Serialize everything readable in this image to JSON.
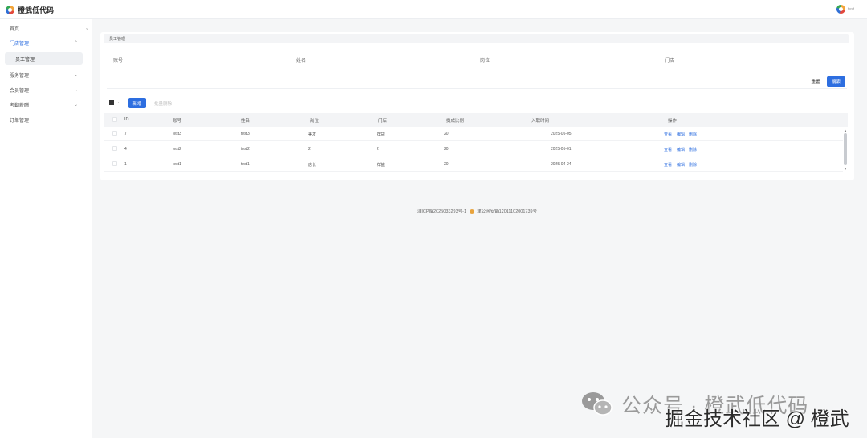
{
  "app": {
    "brand": "橙武低代码",
    "user": "test"
  },
  "sidebar": {
    "items": [
      {
        "label": "首页"
      },
      {
        "label": "门店管理"
      },
      {
        "label": "员工管理"
      },
      {
        "label": "服务管理"
      },
      {
        "label": "会员管理"
      },
      {
        "label": "考勤薪酬"
      },
      {
        "label": "订单管理"
      }
    ]
  },
  "breadcrumb": "员工管理",
  "filters": {
    "account": "账号",
    "name": "姓名",
    "position": "岗位",
    "store": "门店"
  },
  "buttons": {
    "reset": "重置",
    "search": "搜索",
    "new": "新增",
    "batch_delete": "批量删除"
  },
  "table": {
    "columns": [
      "ID",
      "账号",
      "姓名",
      "岗位",
      "门店",
      "提成比例",
      "入职时间",
      "操作"
    ],
    "rows": [
      {
        "id": "7",
        "account": "test3",
        "name": "test3",
        "position": "美发",
        "store": "祥益",
        "ratio": "20",
        "date": "2025-05-05"
      },
      {
        "id": "4",
        "account": "test2",
        "name": "test2",
        "position": "2",
        "store": "2",
        "ratio": "20",
        "date": "2025-05-01"
      },
      {
        "id": "1",
        "account": "test1",
        "name": "test1",
        "position": "店长",
        "store": "祥益",
        "ratio": "20",
        "date": "2025-04-24"
      }
    ],
    "actions": {
      "view": "查看",
      "edit": "编辑",
      "delete": "删除"
    }
  },
  "footer": {
    "icp": "津ICP备2025033293号-1",
    "police": "津公网安备12011102001739号"
  },
  "watermark": {
    "line1": "公众号 · 橙武低代码",
    "line2": "掘金技术社区 @ 橙武"
  },
  "colors": {
    "accent": "#2d6ee0"
  }
}
